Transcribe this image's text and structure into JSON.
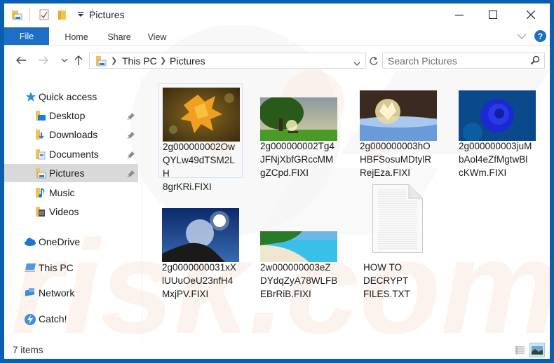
{
  "window": {
    "title": "Pictures",
    "controls": {
      "minimize": "minimize",
      "maximize": "maximize",
      "close": "close"
    }
  },
  "ribbon": {
    "tabs": [
      {
        "label": "File",
        "active": true
      },
      {
        "label": "Home"
      },
      {
        "label": "Share"
      },
      {
        "label": "View"
      }
    ],
    "accent": "#1d6ec4"
  },
  "address": {
    "crumbs": [
      "This PC",
      "Pictures"
    ],
    "search_placeholder": "Search Pictures"
  },
  "nav": {
    "quick_access": "Quick access",
    "items": [
      {
        "label": "Desktop",
        "pinned": true,
        "icon": "desktop-folder-icon"
      },
      {
        "label": "Downloads",
        "pinned": true,
        "icon": "downloads-folder-icon"
      },
      {
        "label": "Documents",
        "pinned": true,
        "icon": "documents-folder-icon"
      },
      {
        "label": "Pictures",
        "pinned": true,
        "icon": "pictures-folder-icon",
        "selected": true
      },
      {
        "label": "Music",
        "pinned": false,
        "icon": "music-folder-icon"
      },
      {
        "label": "Videos",
        "pinned": false,
        "icon": "videos-folder-icon"
      }
    ],
    "locations": [
      {
        "label": "OneDrive",
        "icon": "onedrive-cloud-icon"
      },
      {
        "label": "This PC",
        "icon": "computer-icon"
      },
      {
        "label": "Network",
        "icon": "network-icon"
      },
      {
        "label": "Catch!",
        "icon": "catch-bolt-icon"
      }
    ]
  },
  "files": [
    {
      "name": "2g000000002OwQYLw49dTSM2LH8grKRi.FIXI",
      "lines": [
        "2g000000002Ow",
        "QYLw49dTSM2LH",
        "8grKRi.FIXI"
      ],
      "thumb": "autumn-leaf",
      "selected": true
    },
    {
      "name": "2g000000002Tg4JFNjXbfGRccMMgZCpd.FIXI",
      "lines": [
        "2g000000002Tg4",
        "JFNjXbfGRccMM",
        "gZCpd.FIXI"
      ],
      "thumb": "tree-field"
    },
    {
      "name": "2g000000003hOHBFSosuMDtylRRejEza.FIXI",
      "lines": [
        "2g000000003hO",
        "HBFSosuMDtylR",
        "RejEza.FIXI"
      ],
      "thumb": "frozen-bubble"
    },
    {
      "name": "2g000000003juMbAol4eZfMgtwBlcKWm.FIXI",
      "lines": [
        "2g000000003juM",
        "bAol4eZfMgtwBl",
        "cKWm.FIXI"
      ],
      "thumb": "blue-rose"
    },
    {
      "name": "2g0000000031xXlUUuOeU23nfH4MxjPV.FIXI",
      "lines": [
        "2g0000000031xX",
        "lUUuOeU23nfH4",
        "MxjPV.FIXI"
      ],
      "thumb": "moon-bubble"
    },
    {
      "name": "2w000000003eZDYdqZyA78WLFBEBrRiB.FIXI",
      "lines": [
        "2w000000003eZ",
        "DYdqZyA78WLFB",
        "EBrRiB.FIXI"
      ],
      "thumb": "beach"
    },
    {
      "name": "HOW TO DECRYPT FILES.TXT",
      "lines": [
        "HOW TO",
        "DECRYPT",
        "FILES.TXT"
      ],
      "thumb": "text-document"
    }
  ],
  "status": {
    "item_count": "7 items",
    "views": [
      "details-view",
      "large-icons-view"
    ],
    "active_view": "large-icons-view"
  }
}
